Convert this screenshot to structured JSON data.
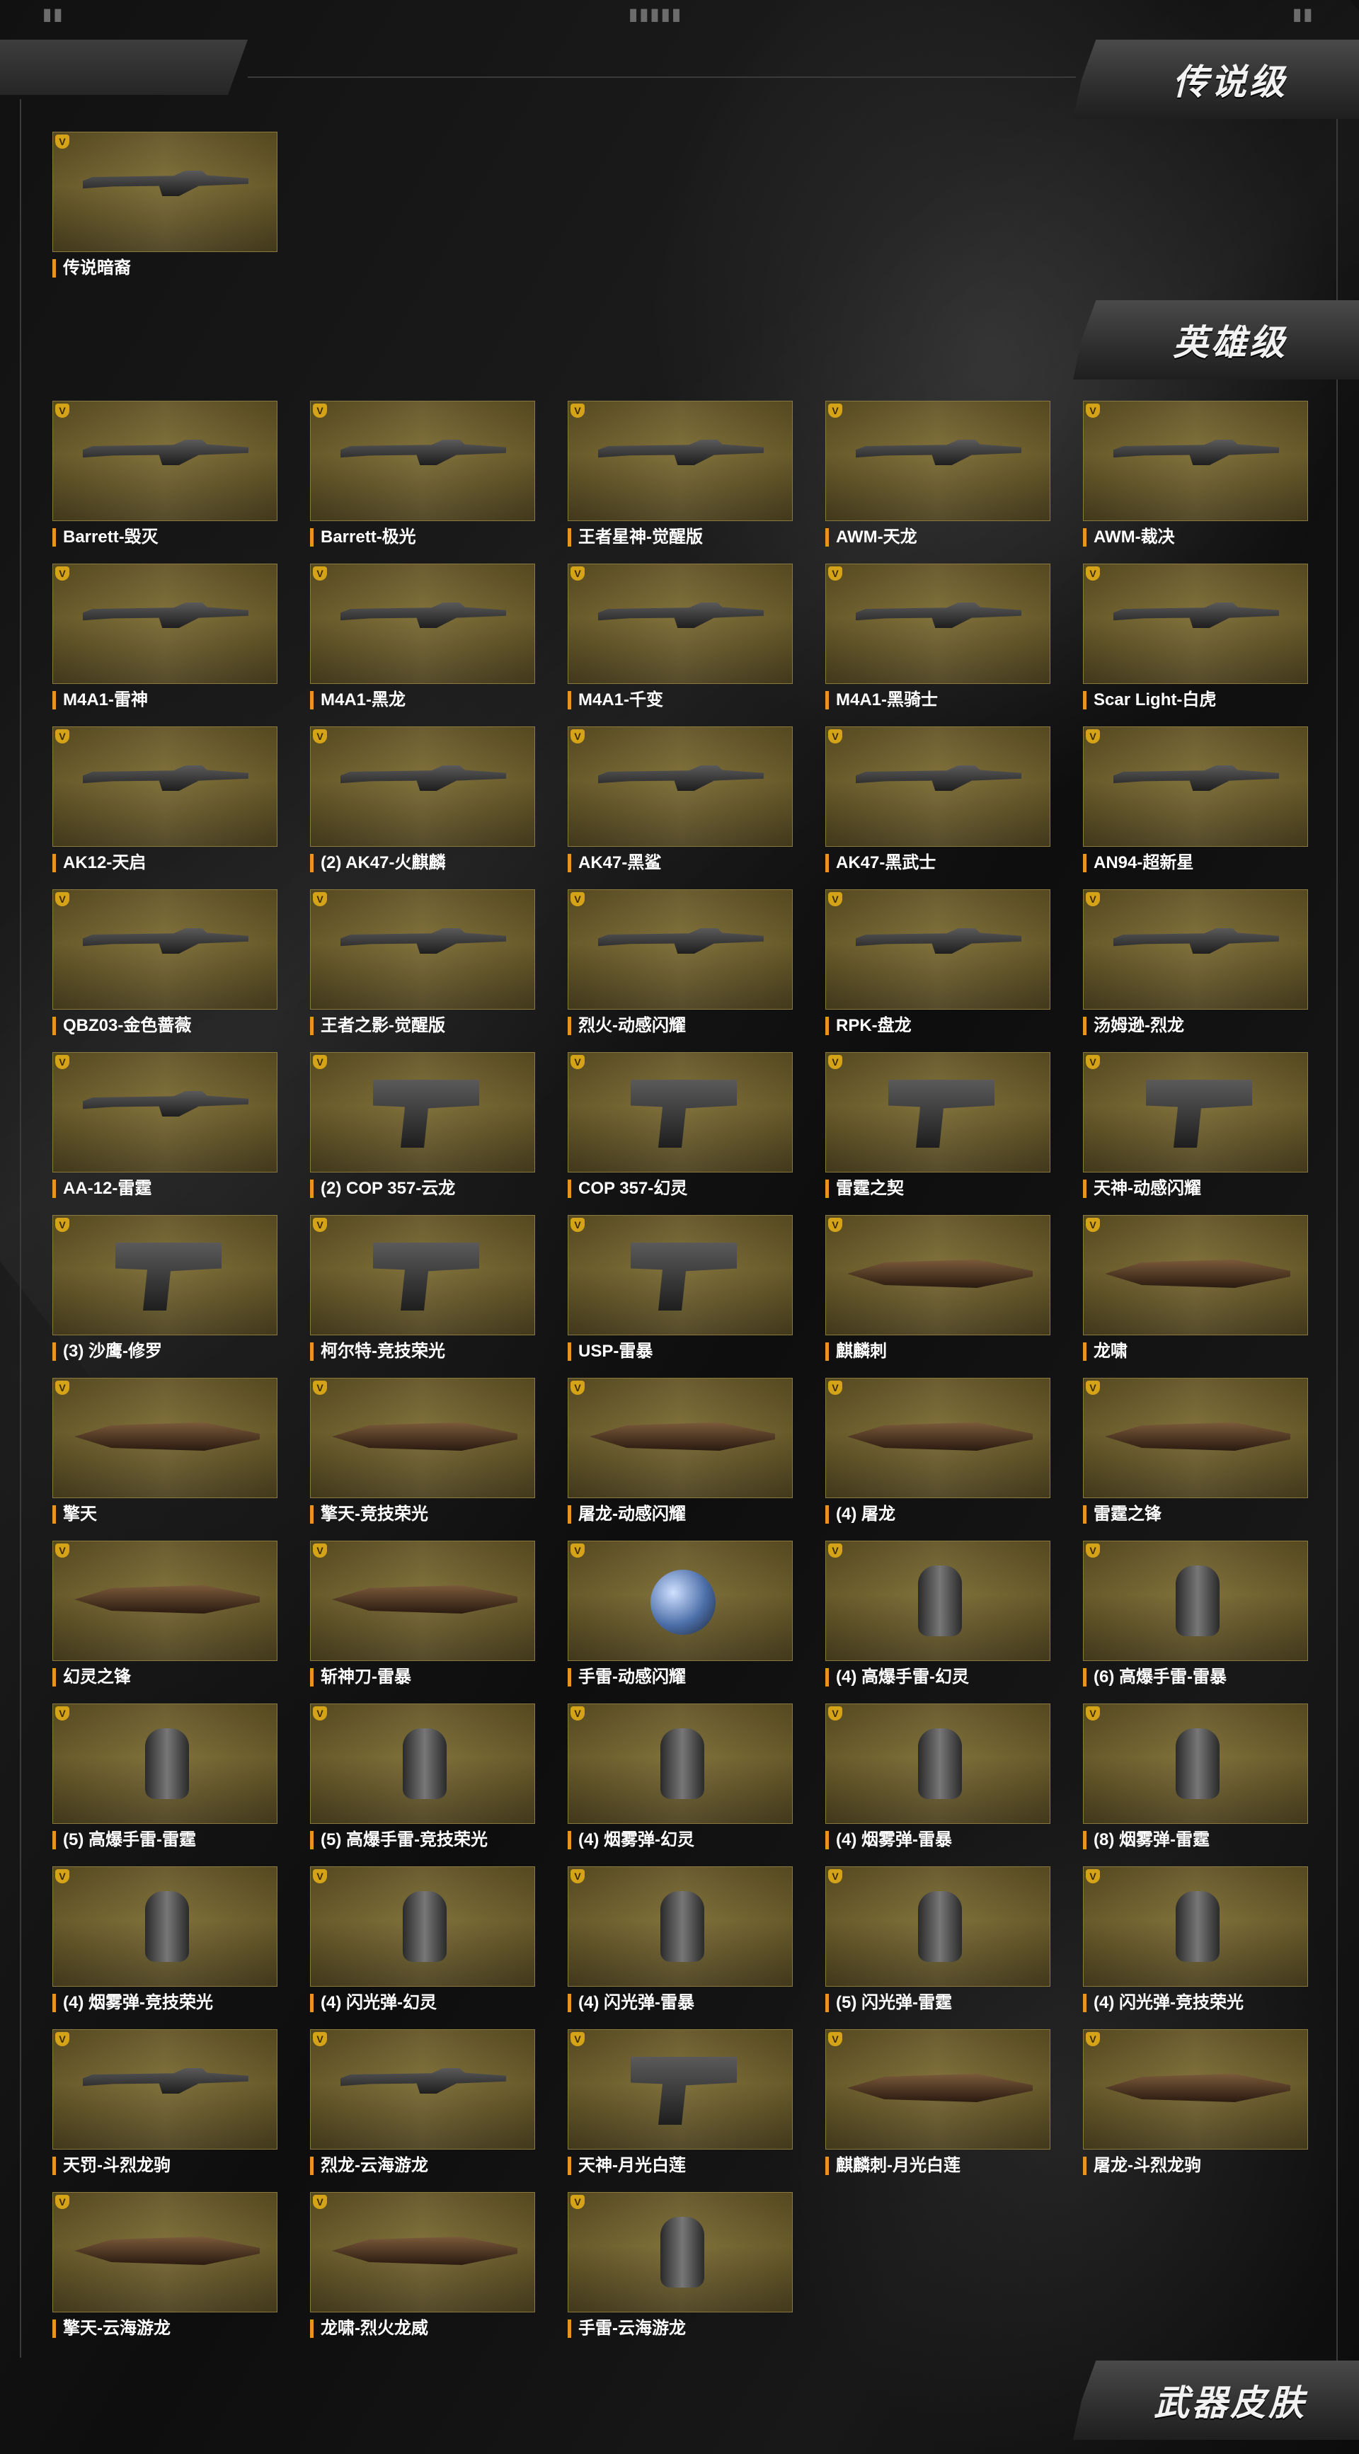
{
  "top_marks": [
    "▮▮",
    "▮▮▮▮▮",
    "▮▮"
  ],
  "sections": {
    "legendary": "传说级",
    "heroic": "英雄级",
    "footer": "武器皮肤"
  },
  "legendary_items": [
    "传说暗裔"
  ],
  "heroic_items": [
    "Barrett-毁灭",
    "Barrett-极光",
    "王者星神-觉醒版",
    "AWM-天龙",
    "AWM-裁决",
    "M4A1-雷神",
    "M4A1-黑龙",
    "M4A1-千变",
    "M4A1-黑骑士",
    "Scar Light-白虎",
    "AK12-天启",
    "(2) AK47-火麒麟",
    "AK47-黑鲨",
    "AK47-黑武士",
    "AN94-超新星",
    "QBZ03-金色蔷薇",
    "王者之影-觉醒版",
    "烈火-动感闪耀",
    "RPK-盘龙",
    "汤姆逊-烈龙",
    "AA-12-雷霆",
    "(2) COP 357-云龙",
    "COP 357-幻灵",
    "雷霆之契",
    "天神-动感闪耀",
    "(3) 沙鹰-修罗",
    "柯尔特-竞技荣光",
    "USP-雷暴",
    "麒麟刺",
    "龙啸",
    "擎天",
    "擎天-竞技荣光",
    "屠龙-动感闪耀",
    "(4) 屠龙",
    "雷霆之锋",
    "幻灵之锋",
    "斩神刀-雷暴",
    "手雷-动感闪耀",
    "(4) 高爆手雷-幻灵",
    "(6) 高爆手雷-雷暴",
    "(5) 高爆手雷-雷霆",
    "(5) 高爆手雷-竞技荣光",
    "(4) 烟雾弹-幻灵",
    "(4) 烟雾弹-雷暴",
    "(8) 烟雾弹-雷霆",
    "(4) 烟雾弹-竞技荣光",
    "(4) 闪光弹-幻灵",
    "(4) 闪光弹-雷暴",
    "(5) 闪光弹-雷霆",
    "(4) 闪光弹-竞技荣光",
    "天罚-斗烈龙驹",
    "烈龙-云海游龙",
    "天神-月光白莲",
    "麒麟刺-月光白莲",
    "屠龙-斗烈龙驹",
    "擎天-云海游龙",
    "龙啸-烈火龙威",
    "手雷-云海游龙"
  ],
  "rarity_badge": "V",
  "colors": {
    "card_gold": "#7a6a31",
    "label_accent": "#e8951b",
    "badge": "#d4a318"
  }
}
